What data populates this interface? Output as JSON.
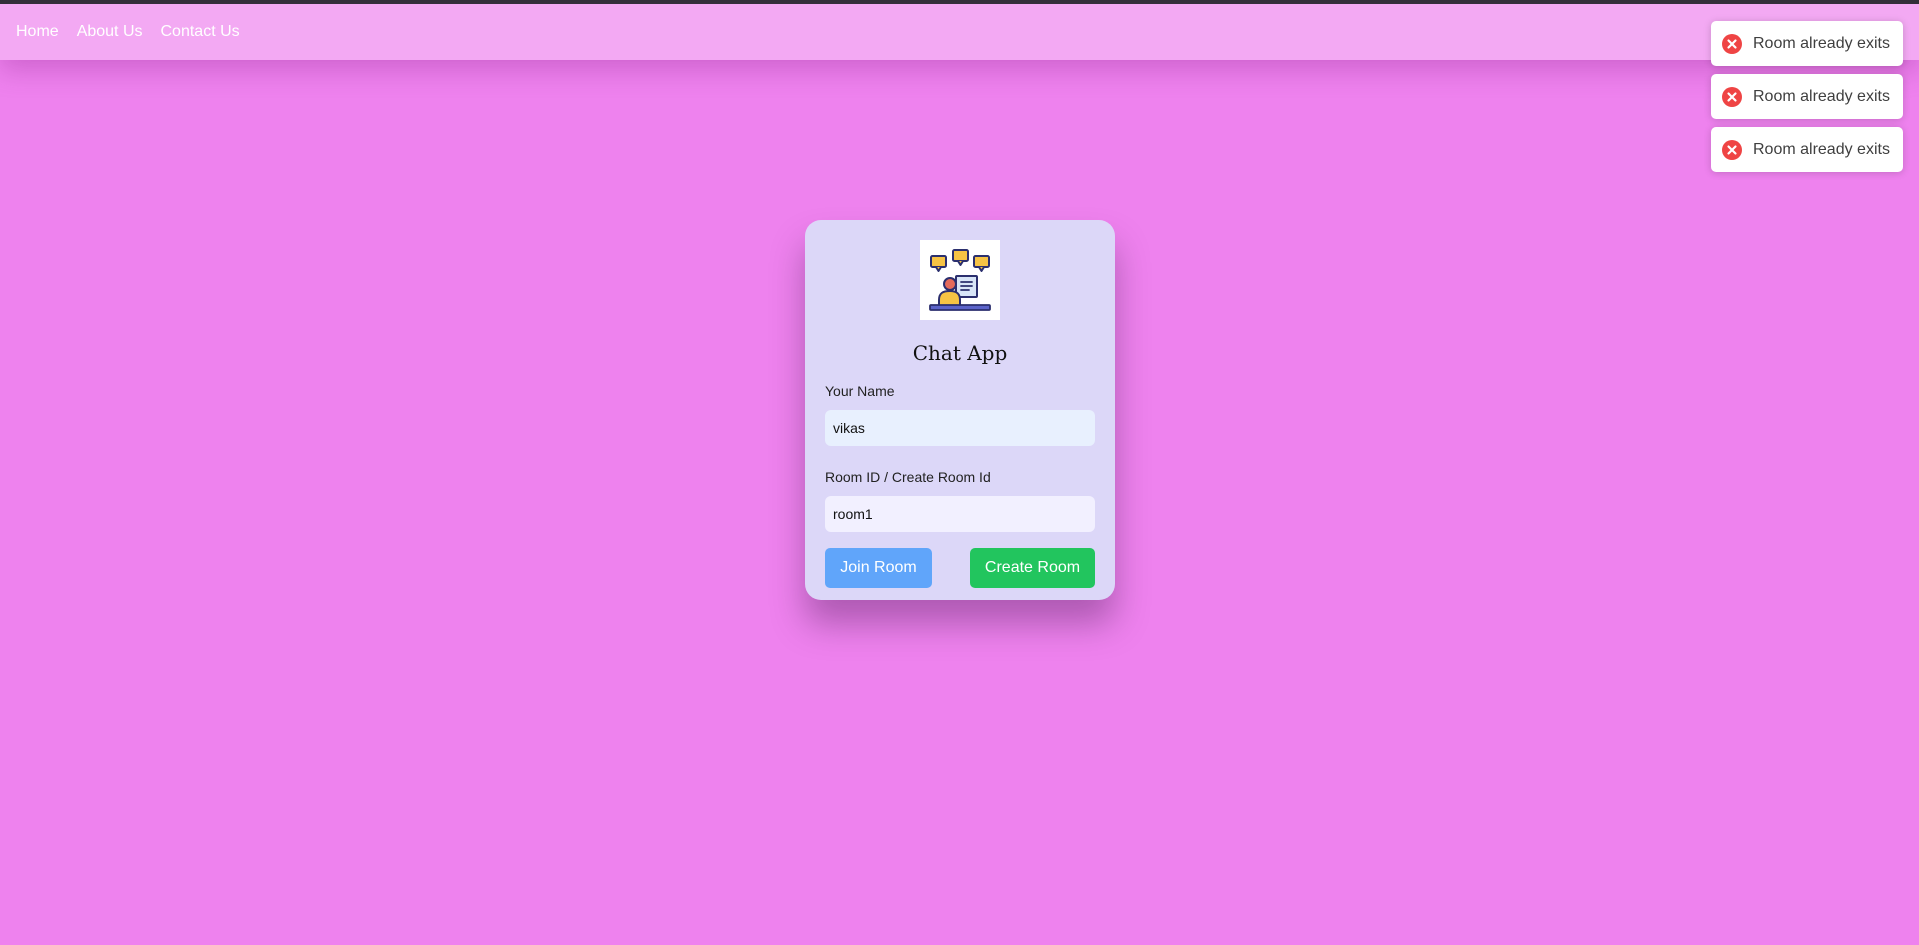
{
  "nav": {
    "items": [
      "Home",
      "About Us",
      "Contact Us"
    ]
  },
  "toasts": [
    {
      "message": "Room already exits",
      "icon": "error-circle-icon",
      "color": "#ef4444"
    },
    {
      "message": "Room already exits",
      "icon": "error-circle-icon",
      "color": "#ef4444"
    },
    {
      "message": "Room already exits",
      "icon": "error-circle-icon",
      "color": "#ef4444"
    }
  ],
  "card": {
    "logo_icon": "chat-support-agent-icon",
    "title": "Chat App",
    "name_label": "Your Name",
    "name_value": "vikas",
    "room_label": "Room ID / Create Room Id",
    "room_value": "room1",
    "join_label": "Join Room",
    "create_label": "Create Room"
  },
  "colors": {
    "page_background": "#ee82ee",
    "navbar": "#f3a9f3",
    "card": "#dcd7f8",
    "join_button": "#60a5fa",
    "create_button": "#22c55e",
    "error": "#ef4444"
  }
}
